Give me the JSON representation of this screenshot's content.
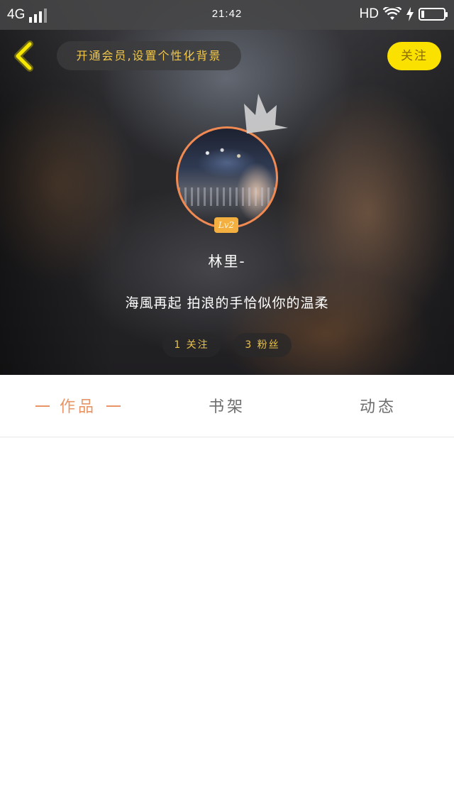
{
  "status_bar": {
    "network": "4G",
    "time": "21:42",
    "hd": "HD"
  },
  "nav": {
    "vip_prompt": "开通会员,设置个性化背景",
    "follow_label": "关注"
  },
  "profile": {
    "level": "Lv2",
    "username": "林里-",
    "bio": "海風再起 拍浪的手恰似你的温柔",
    "following_label": "1 关注",
    "fans_label": "3 粉丝"
  },
  "tabs": [
    {
      "label": "作品",
      "active": true
    },
    {
      "label": "书架",
      "active": false
    },
    {
      "label": "动态",
      "active": false
    }
  ],
  "colors": {
    "accent_yellow": "#fbe100",
    "gold_text": "#f2c84b",
    "active_tab": "#e79566",
    "avatar_border": "#f08a52",
    "level_badge": "#f3b040"
  }
}
